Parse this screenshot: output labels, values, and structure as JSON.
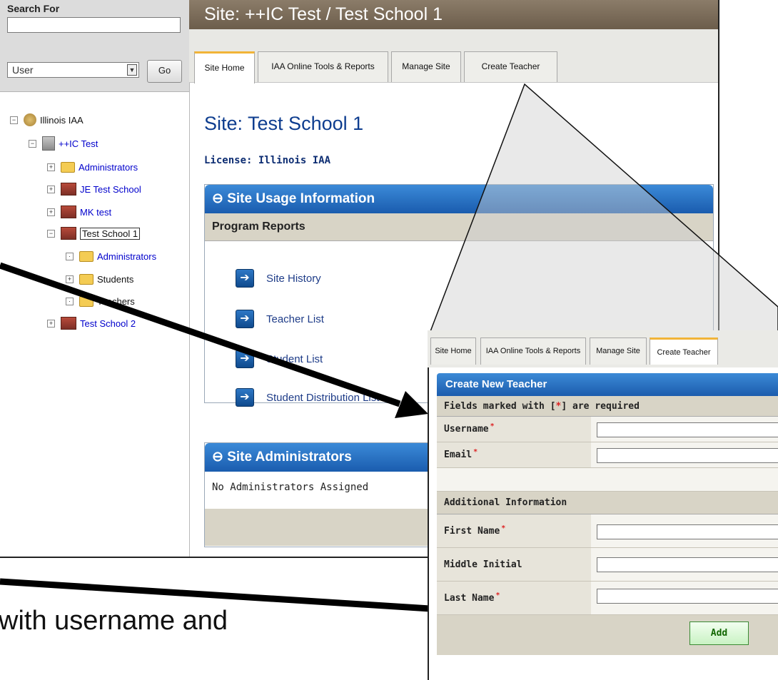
{
  "left_panel": {
    "search_label": "Search For",
    "search_value": "",
    "type_selected": "User",
    "go_label": "Go",
    "tree": [
      {
        "label": "Illinois IAA",
        "toggle": "−",
        "style": "plain"
      },
      {
        "label": "++IC Test",
        "toggle": "−",
        "style": "link"
      },
      {
        "label": "Administrators",
        "toggle": "+",
        "style": "link"
      },
      {
        "label": "JE Test School",
        "toggle": "+",
        "style": "link"
      },
      {
        "label": "MK test",
        "toggle": "+",
        "style": "link"
      },
      {
        "label": "Test School 1",
        "toggle": "−",
        "style": "plain"
      },
      {
        "label": "Administrators",
        "toggle": "·",
        "style": "link"
      },
      {
        "label": "Students",
        "toggle": "+",
        "style": "plain"
      },
      {
        "label": "Teachers",
        "toggle": "·",
        "style": "plain"
      },
      {
        "label": "Test School 2",
        "toggle": "+",
        "style": "link"
      }
    ]
  },
  "header": {
    "title": "Site: ++IC Test / Test School 1"
  },
  "tabs": [
    "Site Home",
    "IAA Online Tools & Reports",
    "Manage Site",
    "Create Teacher"
  ],
  "main": {
    "site_title": "Site: Test School 1",
    "license": "License: Illinois IAA",
    "usage_panel": {
      "title": "Site Usage Information",
      "subheader": "Program Reports",
      "reports": [
        "Site History",
        "Teacher List",
        "Student List",
        "Student Distribution List"
      ]
    },
    "admins_panel": {
      "title": "Site Administrators",
      "empty_text": "No Administrators Assigned"
    }
  },
  "overlay": {
    "tabs": [
      "Site Home",
      "IAA Online Tools & Reports",
      "Manage Site",
      "Create Teacher"
    ],
    "panel_title": "Create New Teacher",
    "required_note_prefix": "Fields marked with [",
    "required_note_star": "*",
    "required_note_suffix": "] are required",
    "fields_top": [
      {
        "label": "Username",
        "required": true,
        "value": ""
      },
      {
        "label": "Email",
        "required": true,
        "value": ""
      }
    ],
    "additional_header": "Additional Information",
    "fields_extra": [
      {
        "label": "First Name",
        "required": true,
        "value": ""
      },
      {
        "label": "Middle Initial",
        "required": false,
        "value": ""
      },
      {
        "label": "Last Name",
        "required": true,
        "value": ""
      }
    ],
    "add_label": "Add"
  },
  "caption": "with username and"
}
